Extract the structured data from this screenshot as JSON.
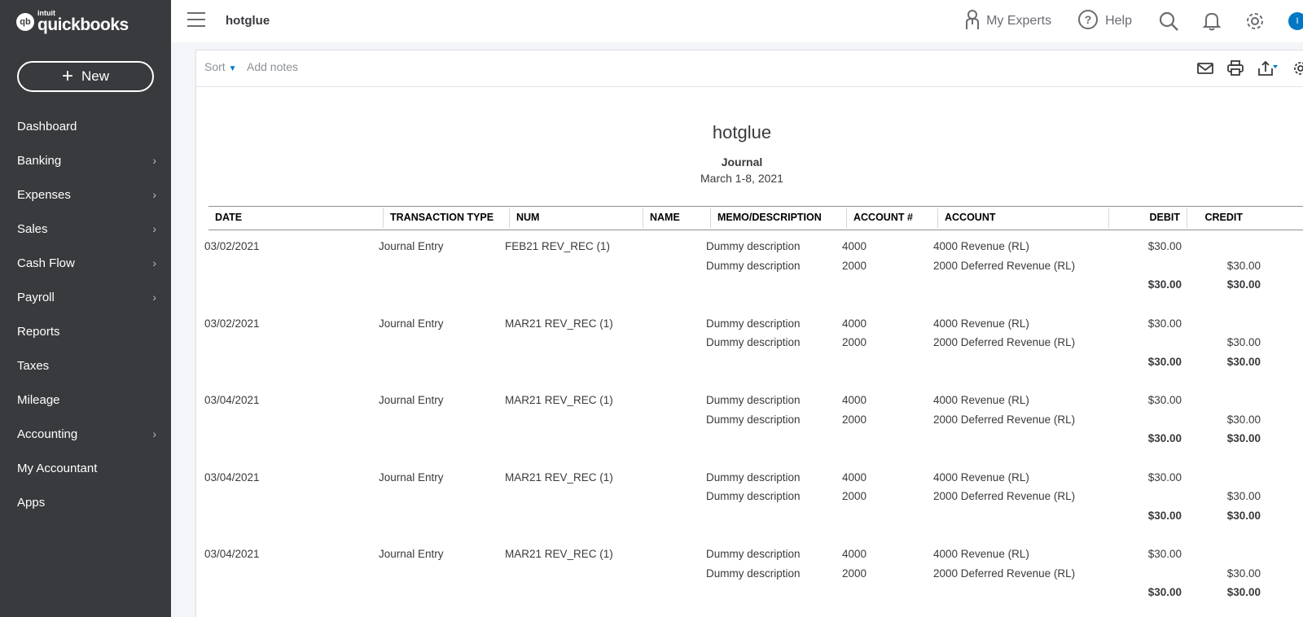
{
  "brand": {
    "badge": "qb",
    "intuit": "intuit",
    "name": "quickbooks"
  },
  "sidebar": {
    "new_label": "New",
    "items": [
      {
        "label": "Dashboard",
        "has_children": false
      },
      {
        "label": "Banking",
        "has_children": true
      },
      {
        "label": "Expenses",
        "has_children": true
      },
      {
        "label": "Sales",
        "has_children": true
      },
      {
        "label": "Cash Flow",
        "has_children": true
      },
      {
        "label": "Payroll",
        "has_children": true
      },
      {
        "label": "Reports",
        "has_children": false
      },
      {
        "label": "Taxes",
        "has_children": false
      },
      {
        "label": "Mileage",
        "has_children": false
      },
      {
        "label": "Accounting",
        "has_children": true
      },
      {
        "label": "My Accountant",
        "has_children": false
      },
      {
        "label": "Apps",
        "has_children": false
      }
    ]
  },
  "topbar": {
    "company": "hotglue",
    "my_experts": "My Experts",
    "help": "Help",
    "avatar_initial": "I"
  },
  "toolbar": {
    "sort": "Sort",
    "add_notes": "Add notes"
  },
  "report": {
    "title": "hotglue",
    "subtitle": "Journal",
    "range": "March 1-8, 2021",
    "columns": [
      "DATE",
      "TRANSACTION TYPE",
      "NUM",
      "NAME",
      "MEMO/DESCRIPTION",
      "ACCOUNT #",
      "ACCOUNT",
      "DEBIT",
      "CREDIT"
    ],
    "entries": [
      {
        "date": "03/02/2021",
        "type": "Journal Entry",
        "num": "FEB21 REV_REC (1)",
        "lines": [
          {
            "memo": "Dummy description",
            "acct_no": "4000",
            "account": "4000 Revenue (RL)",
            "debit": "$30.00",
            "credit": ""
          },
          {
            "memo": "Dummy description",
            "acct_no": "2000",
            "account": "2000 Deferred Revenue (RL)",
            "debit": "",
            "credit": "$30.00"
          }
        ],
        "total_debit": "$30.00",
        "total_credit": "$30.00"
      },
      {
        "date": "03/02/2021",
        "type": "Journal Entry",
        "num": "MAR21 REV_REC (1)",
        "lines": [
          {
            "memo": "Dummy description",
            "acct_no": "4000",
            "account": "4000 Revenue (RL)",
            "debit": "$30.00",
            "credit": ""
          },
          {
            "memo": "Dummy description",
            "acct_no": "2000",
            "account": "2000 Deferred Revenue (RL)",
            "debit": "",
            "credit": "$30.00"
          }
        ],
        "total_debit": "$30.00",
        "total_credit": "$30.00"
      },
      {
        "date": "03/04/2021",
        "type": "Journal Entry",
        "num": "MAR21 REV_REC (1)",
        "lines": [
          {
            "memo": "Dummy description",
            "acct_no": "4000",
            "account": "4000 Revenue (RL)",
            "debit": "$30.00",
            "credit": ""
          },
          {
            "memo": "Dummy description",
            "acct_no": "2000",
            "account": "2000 Deferred Revenue (RL)",
            "debit": "",
            "credit": "$30.00"
          }
        ],
        "total_debit": "$30.00",
        "total_credit": "$30.00"
      },
      {
        "date": "03/04/2021",
        "type": "Journal Entry",
        "num": "MAR21 REV_REC (1)",
        "lines": [
          {
            "memo": "Dummy description",
            "acct_no": "4000",
            "account": "4000 Revenue (RL)",
            "debit": "$30.00",
            "credit": ""
          },
          {
            "memo": "Dummy description",
            "acct_no": "2000",
            "account": "2000 Deferred Revenue (RL)",
            "debit": "",
            "credit": "$30.00"
          }
        ],
        "total_debit": "$30.00",
        "total_credit": "$30.00"
      },
      {
        "date": "03/04/2021",
        "type": "Journal Entry",
        "num": "MAR21 REV_REC (1)",
        "lines": [
          {
            "memo": "Dummy description",
            "acct_no": "4000",
            "account": "4000 Revenue (RL)",
            "debit": "$30.00",
            "credit": ""
          },
          {
            "memo": "Dummy description",
            "acct_no": "2000",
            "account": "2000 Deferred Revenue (RL)",
            "debit": "",
            "credit": "$30.00"
          }
        ],
        "total_debit": "$30.00",
        "total_credit": "$30.00"
      }
    ]
  },
  "icons": {
    "menu": "hamburger-menu-icon",
    "experts": "person-icon",
    "help": "help-circle-icon",
    "search": "search-icon",
    "notifications": "bell-icon",
    "settings": "gear-icon",
    "email": "email-icon",
    "print": "print-icon",
    "export": "export-icon",
    "report_settings": "gear-icon"
  },
  "colors": {
    "sidebar_bg": "#393a3d",
    "accent_blue": "#0077c5",
    "muted_text": "#8d9096"
  }
}
